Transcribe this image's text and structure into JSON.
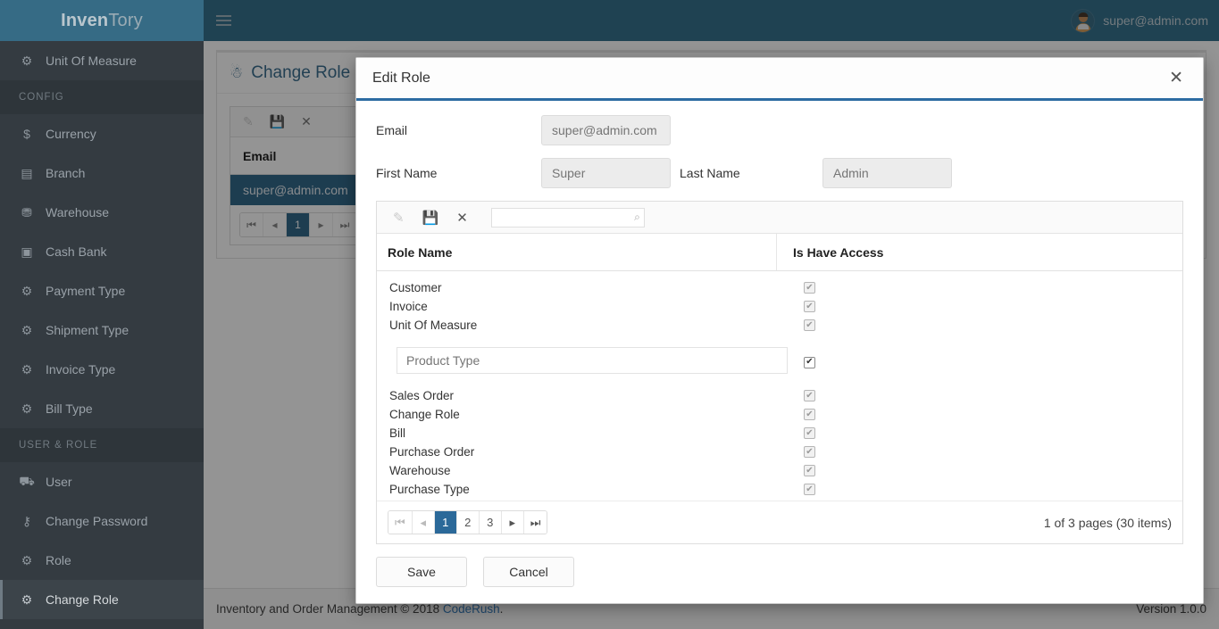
{
  "app": {
    "brand_bold": "Inven",
    "brand_light": "Tory",
    "user_email": "super@admin.com"
  },
  "sidebar": {
    "items": [
      {
        "label": "Unit Of Measure",
        "icon": "gear-icon",
        "glyph": "⚙",
        "type": "item",
        "active": false
      },
      {
        "label": "CONFIG",
        "type": "header"
      },
      {
        "label": "Currency",
        "icon": "dollar-icon",
        "glyph": "$",
        "type": "item",
        "active": false
      },
      {
        "label": "Branch",
        "icon": "building-icon",
        "glyph": "▤",
        "type": "item",
        "active": false
      },
      {
        "label": "Warehouse",
        "icon": "warehouse-icon",
        "glyph": "⛃",
        "type": "item",
        "active": false
      },
      {
        "label": "Cash Bank",
        "icon": "money-icon",
        "glyph": "▣",
        "type": "item",
        "active": false
      },
      {
        "label": "Payment Type",
        "icon": "gear-icon",
        "glyph": "⚙",
        "type": "item",
        "active": false
      },
      {
        "label": "Shipment Type",
        "icon": "gear-icon",
        "glyph": "⚙",
        "type": "item",
        "active": false
      },
      {
        "label": "Invoice Type",
        "icon": "gear-icon",
        "glyph": "⚙",
        "type": "item",
        "active": false
      },
      {
        "label": "Bill Type",
        "icon": "gear-icon",
        "glyph": "⚙",
        "type": "item",
        "active": false
      },
      {
        "label": "USER & ROLE",
        "type": "header"
      },
      {
        "label": "User",
        "icon": "users-icon",
        "glyph": "⛟",
        "type": "item",
        "active": false
      },
      {
        "label": "Change Password",
        "icon": "key-icon",
        "glyph": "⚷",
        "type": "item",
        "active": false
      },
      {
        "label": "Role",
        "icon": "gear-icon",
        "glyph": "⚙",
        "type": "item",
        "active": false
      },
      {
        "label": "Change Role",
        "icon": "gear-icon",
        "glyph": "⚙",
        "type": "item",
        "active": true
      }
    ]
  },
  "page": {
    "title": "Change Role",
    "toolbar": {
      "edit": "✎",
      "save": "💾",
      "cancel": "✕"
    },
    "grid": {
      "header": "Email",
      "rows": [
        "super@admin.com"
      ],
      "pager": {
        "first": "⏮",
        "prev": "◂",
        "pages": [
          "1"
        ],
        "next": "▸",
        "last": "⏭",
        "current": "1"
      }
    }
  },
  "footer": {
    "text_before": "Inventory and Order Management © 2018 ",
    "link": "CodeRush",
    "text_after": ".",
    "version": "Version 1.0.0"
  },
  "modal": {
    "title": "Edit Role",
    "close": "✕",
    "fields": {
      "email_label": "Email",
      "email_value": "super@admin.com",
      "first_name_label": "First Name",
      "first_name_value": "Super",
      "last_name_label": "Last Name",
      "last_name_value": "Admin"
    },
    "grid_toolbar": {
      "edit_icon": "✎",
      "save_icon": "💾",
      "cancel_icon": "✕",
      "search_value": "",
      "search_placeholder": "",
      "search_icon": "🔍"
    },
    "grid": {
      "columns": [
        "Role Name",
        "Is Have Access"
      ],
      "rows": [
        {
          "name": "Customer",
          "access": true,
          "editing": false
        },
        {
          "name": "Invoice",
          "access": true,
          "editing": false
        },
        {
          "name": "Unit Of Measure",
          "access": true,
          "editing": false
        },
        {
          "name": "Product Type",
          "access": true,
          "editing": true
        },
        {
          "name": "Sales Order",
          "access": true,
          "editing": false
        },
        {
          "name": "Change Role",
          "access": true,
          "editing": false
        },
        {
          "name": "Bill",
          "access": true,
          "editing": false
        },
        {
          "name": "Purchase Order",
          "access": true,
          "editing": false
        },
        {
          "name": "Warehouse",
          "access": true,
          "editing": false
        },
        {
          "name": "Purchase Type",
          "access": true,
          "editing": false
        }
      ],
      "check_glyph": "✔",
      "pager": {
        "first": "⏮",
        "prev": "◂",
        "pages": [
          "1",
          "2",
          "3"
        ],
        "next": "▸",
        "last": "⏭",
        "current": "1",
        "info": "1 of 3 pages (30 items)"
      }
    },
    "buttons": {
      "save": "Save",
      "cancel": "Cancel"
    }
  },
  "colors": {
    "brand_dark": "#366b85",
    "topbar": "#36728e",
    "sidebar": "#343b41",
    "accent_blue": "#2d6ca2",
    "selected_row": "#336a8b",
    "link": "#3a7fbd"
  }
}
